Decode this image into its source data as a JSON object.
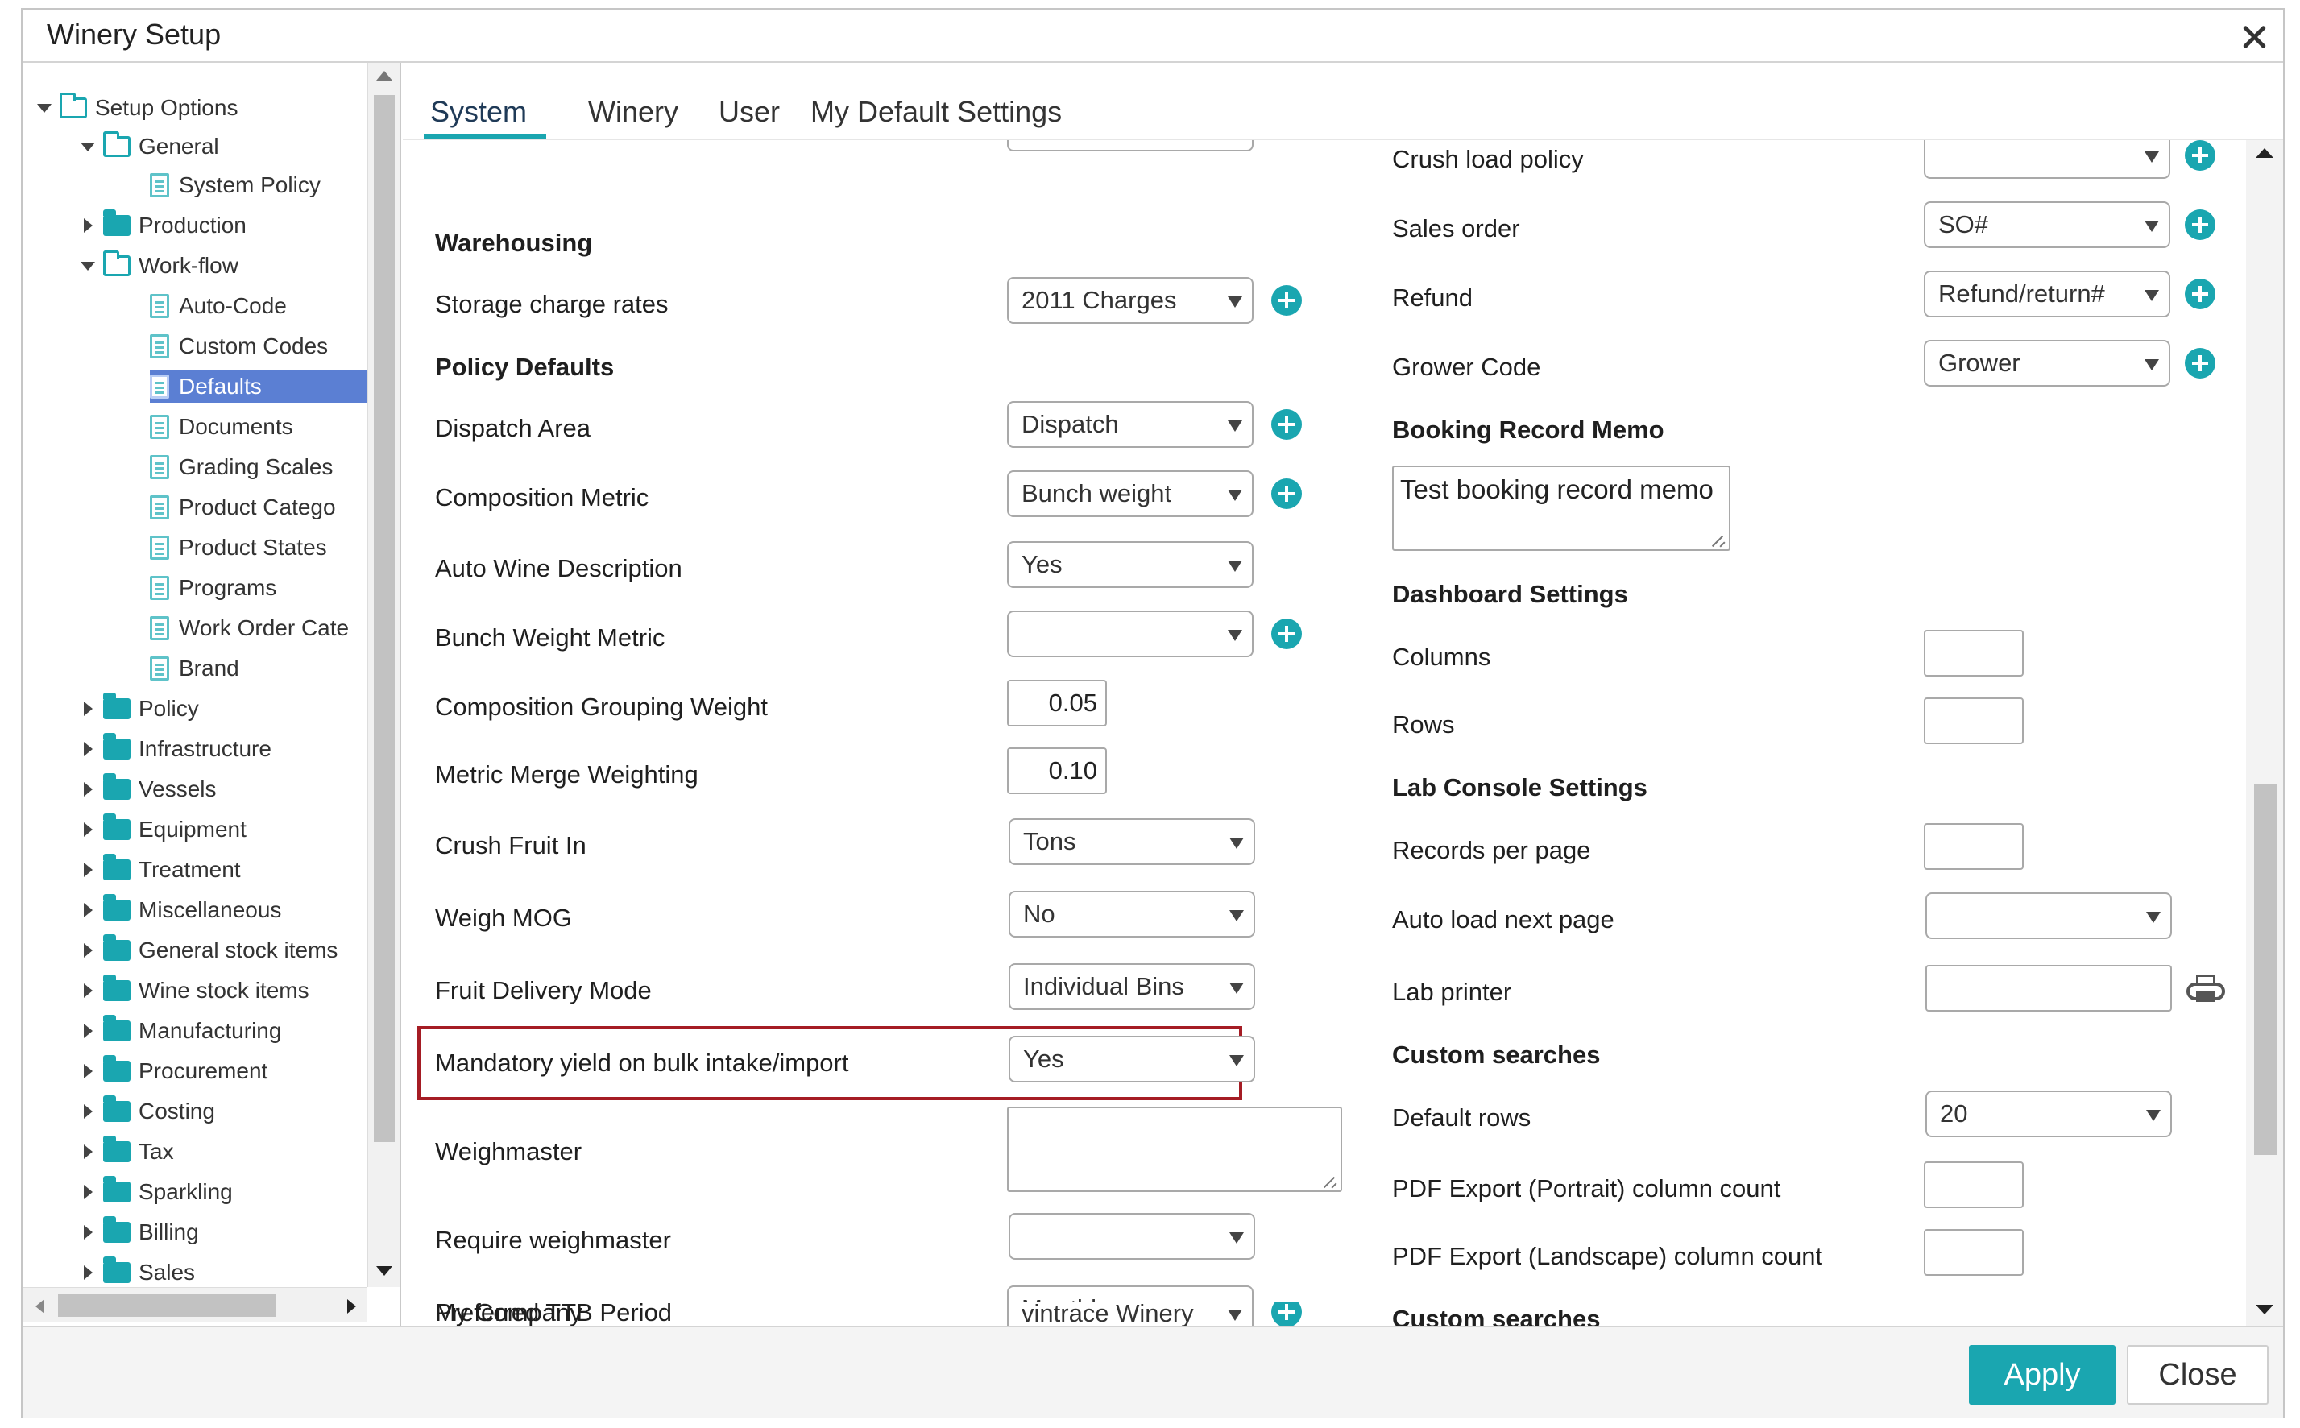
{
  "window": {
    "title": "Winery Setup"
  },
  "tree": {
    "root": "Setup Options",
    "general": "General",
    "system_policy": "System Policy",
    "production": "Production",
    "workflow": "Work-flow",
    "auto_code": "Auto-Code",
    "custom_codes": "Custom Codes",
    "defaults": "Defaults",
    "documents": "Documents",
    "grading_scales": "Grading Scales",
    "product_catego": "Product Catego",
    "product_states": "Product States",
    "programs": "Programs",
    "work_order_cat": "Work Order Cate",
    "brand": "Brand",
    "policy": "Policy",
    "infrastructure": "Infrastructure",
    "vessels": "Vessels",
    "equipment": "Equipment",
    "treatment": "Treatment",
    "miscellaneous": "Miscellaneous",
    "general_stock": "General stock items",
    "wine_stock": "Wine stock items",
    "manufacturing": "Manufacturing",
    "procurement": "Procurement",
    "costing": "Costing",
    "tax": "Tax",
    "sparkling": "Sparkling",
    "billing": "Billing",
    "sales": "Sales"
  },
  "tabs": {
    "system": "System",
    "winery": "Winery",
    "user": "User",
    "my_default": "My Default Settings"
  },
  "left": {
    "warehousing": "Warehousing",
    "storage_charge_rates": {
      "label": "Storage charge rates",
      "value": "2011 Charges"
    },
    "policy_defaults": "Policy Defaults",
    "dispatch_area": {
      "label": "Dispatch Area",
      "value": "Dispatch"
    },
    "composition_metric": {
      "label": "Composition Metric",
      "value": "Bunch weight"
    },
    "auto_wine_description": {
      "label": "Auto Wine Description",
      "value": "Yes"
    },
    "bunch_weight_metric": {
      "label": "Bunch Weight Metric",
      "value": ""
    },
    "composition_grouping_weight": {
      "label": "Composition Grouping Weight",
      "value": "0.05"
    },
    "metric_merge_weighting": {
      "label": "Metric Merge Weighting",
      "value": "0.10"
    },
    "crush_fruit_in": {
      "label": "Crush Fruit In",
      "value": "Tons"
    },
    "weigh_mog": {
      "label": "Weigh MOG",
      "value": "No"
    },
    "fruit_delivery_mode": {
      "label": "Fruit Delivery Mode",
      "value": "Individual Bins"
    },
    "mandatory_yield": {
      "label": "Mandatory yield on bulk intake/import",
      "value": "Yes"
    },
    "weighmaster": {
      "label": "Weighmaster",
      "value": ""
    },
    "require_weighmaster": {
      "label": "Require weighmaster",
      "value": ""
    },
    "preferred_ttb": {
      "label": "Preferred TTB Period",
      "value": "Monthly"
    },
    "my_company": {
      "label": "My Company",
      "value": "vintrace Winery"
    }
  },
  "right": {
    "crush_load_policy": {
      "label": "Crush load policy",
      "value": ""
    },
    "sales_order": {
      "label": "Sales order",
      "value": "SO#"
    },
    "refund": {
      "label": "Refund",
      "value": "Refund/return#"
    },
    "grower_code": {
      "label": "Grower Code",
      "value": "Grower"
    },
    "booking_record_memo": {
      "label": "Booking Record Memo",
      "value": "Test booking record memo"
    },
    "dashboard_settings": "Dashboard Settings",
    "columns": {
      "label": "Columns",
      "value": ""
    },
    "rows": {
      "label": "Rows",
      "value": ""
    },
    "lab_console_settings": "Lab Console Settings",
    "records_per_page": {
      "label": "Records per page",
      "value": ""
    },
    "auto_load_next_page": {
      "label": "Auto load next page",
      "value": ""
    },
    "lab_printer": {
      "label": "Lab printer",
      "value": ""
    },
    "custom_searches": "Custom searches",
    "default_rows": {
      "label": "Default rows",
      "value": "20"
    },
    "pdf_portrait": {
      "label": "PDF Export (Portrait) column count",
      "value": ""
    },
    "pdf_landscape": {
      "label": "PDF Export (Landscape) column count",
      "value": ""
    },
    "custom_searches_2": "Custom searches"
  },
  "footer": {
    "apply": "Apply",
    "close": "Close"
  },
  "colors": {
    "accent": "#1aa6b0",
    "selection": "#5b7fd3",
    "highlight_border": "#a51c24"
  }
}
